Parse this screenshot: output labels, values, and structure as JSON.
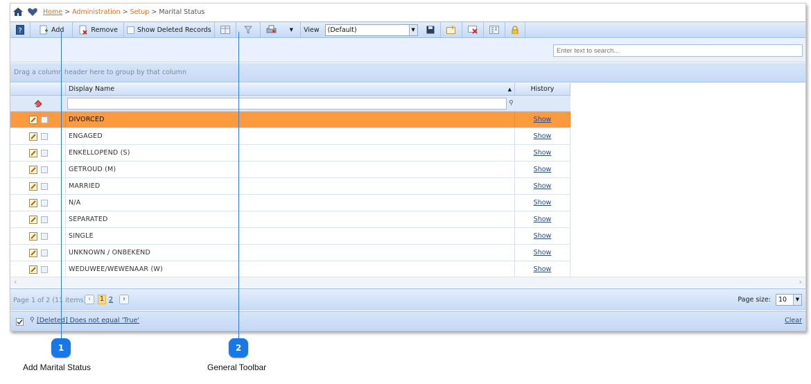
{
  "breadcrumb": {
    "home": "Home",
    "sep": ">",
    "admin": "Administration",
    "setup": "Setup",
    "current": "Marital Status"
  },
  "toolbar": {
    "add_label": "Add",
    "remove_label": "Remove",
    "show_deleted_label": "Show Deleted Records",
    "view_label": "View",
    "view_value": "(Default)"
  },
  "search": {
    "placeholder": "Enter text to search..."
  },
  "group_panel": {
    "hint": "Drag a column header here to group by that column"
  },
  "grid": {
    "columns": [
      "Display Name",
      "History"
    ],
    "sort_indicator": "▲",
    "rows": [
      {
        "name": "DIVORCED",
        "history": "Show"
      },
      {
        "name": "ENGAGED",
        "history": "Show"
      },
      {
        "name": "ENKELLOPEND (S)",
        "history": "Show"
      },
      {
        "name": "GETROUD (M)",
        "history": "Show"
      },
      {
        "name": "MARRIED",
        "history": "Show"
      },
      {
        "name": "N/A",
        "history": "Show"
      },
      {
        "name": "SEPARATED",
        "history": "Show"
      },
      {
        "name": "SINGLE",
        "history": "Show"
      },
      {
        "name": "UNKNOWN / ONBEKEND",
        "history": "Show"
      },
      {
        "name": "WEDUWEE/WEWENAAR (W)",
        "history": "Show"
      }
    ]
  },
  "pager": {
    "info": "Page 1 of 2 (11 items)",
    "current_page": "1",
    "page_2": "2",
    "page_size_label": "Page size:",
    "page_size": "10"
  },
  "status": {
    "filter_expr": "[Deleted] Does not equal 'True'",
    "clear": "Clear"
  },
  "callouts": [
    {
      "number": "1",
      "caption": "Add Marital Status"
    },
    {
      "number": "2",
      "caption": "General Toolbar"
    }
  ],
  "colors": {
    "selected_row": "#fd9a3e",
    "toolbar": "#c5daf6",
    "callout": "#1a78e6",
    "link_orange": "#e06d10"
  }
}
